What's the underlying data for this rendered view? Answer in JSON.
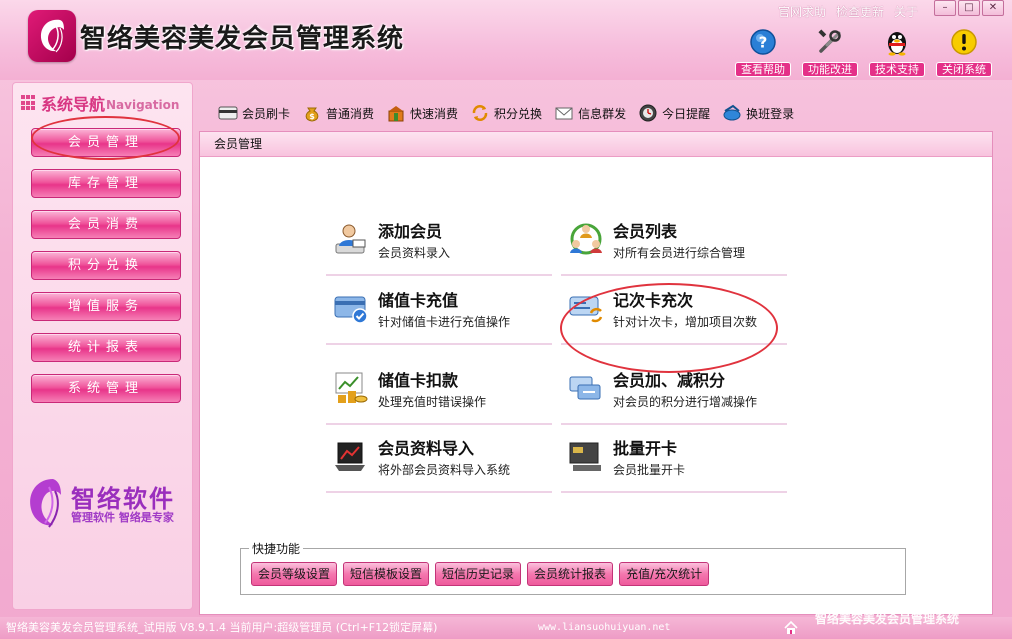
{
  "app": {
    "title": "智络美容美发会员管理系统"
  },
  "top_links": [
    "官网求助",
    "检查更新",
    "关于"
  ],
  "window_controls": [
    "–",
    "□",
    "✕"
  ],
  "header_tools": [
    {
      "label": "查看帮助",
      "icon": "help-icon"
    },
    {
      "label": "功能改进",
      "icon": "tools-icon"
    },
    {
      "label": "技术支持",
      "icon": "support-penguin-icon"
    },
    {
      "label": "关闭系统",
      "icon": "warning-close-icon"
    }
  ],
  "nav": {
    "title": "系统导航",
    "title_en": "Navigation",
    "items": [
      "会员管理",
      "库存管理",
      "会员消费",
      "积分兑换",
      "增值服务",
      "统计报表",
      "系统管理"
    ],
    "brand_name": "智络软件",
    "brand_slogan": "管理软件 智络是专家"
  },
  "toolbar": [
    {
      "label": "会员刷卡",
      "icon": "card-swipe-icon"
    },
    {
      "label": "普通消费",
      "icon": "money-bag-icon"
    },
    {
      "label": "快速消费",
      "icon": "fast-consume-icon"
    },
    {
      "label": "积分兑换",
      "icon": "points-exchange-icon"
    },
    {
      "label": "信息群发",
      "icon": "mail-icon"
    },
    {
      "label": "今日提醒",
      "icon": "reminder-icon"
    },
    {
      "label": "换班登录",
      "icon": "shift-login-icon"
    }
  ],
  "panel": {
    "title": "会员管理",
    "functions": [
      {
        "title": "添加会员",
        "desc": "会员资料录入",
        "icon": "add-member-icon"
      },
      {
        "title": "会员列表",
        "desc": "对所有会员进行综合管理",
        "icon": "member-list-icon"
      },
      {
        "title": "储值卡充值",
        "desc": "针对储值卡进行充值操作",
        "icon": "recharge-card-icon"
      },
      {
        "title": "记次卡充次",
        "desc": "针对计次卡，增加项目次数",
        "icon": "count-card-icon"
      },
      {
        "title": "储值卡扣款",
        "desc": "处理充值时错误操作",
        "icon": "deduct-icon"
      },
      {
        "title": "会员加、减积分",
        "desc": "对会员的积分进行增减操作",
        "icon": "adjust-points-icon"
      },
      {
        "title": "会员资料导入",
        "desc": "将外部会员资料导入系统",
        "icon": "import-icon"
      },
      {
        "title": "批量开卡",
        "desc": "会员批量开卡",
        "icon": "batch-card-icon"
      }
    ]
  },
  "quick": {
    "title": "快捷功能",
    "buttons": [
      "会员等级设置",
      "短信模板设置",
      "短信历史记录",
      "会员统计报表",
      "充值/充次统计"
    ]
  },
  "status": {
    "left": "智络美容美发会员管理系统_试用版 V8.9.1.4 当前用户:超级管理员 (Ctrl+F12锁定屏幕)",
    "url": "www.liansuohuiyuan.net",
    "right": "智络美容美发会员管理系统"
  },
  "colors": {
    "accent": "#e43088",
    "nav_button": "#f0569c",
    "annotation": "#e0333e"
  }
}
